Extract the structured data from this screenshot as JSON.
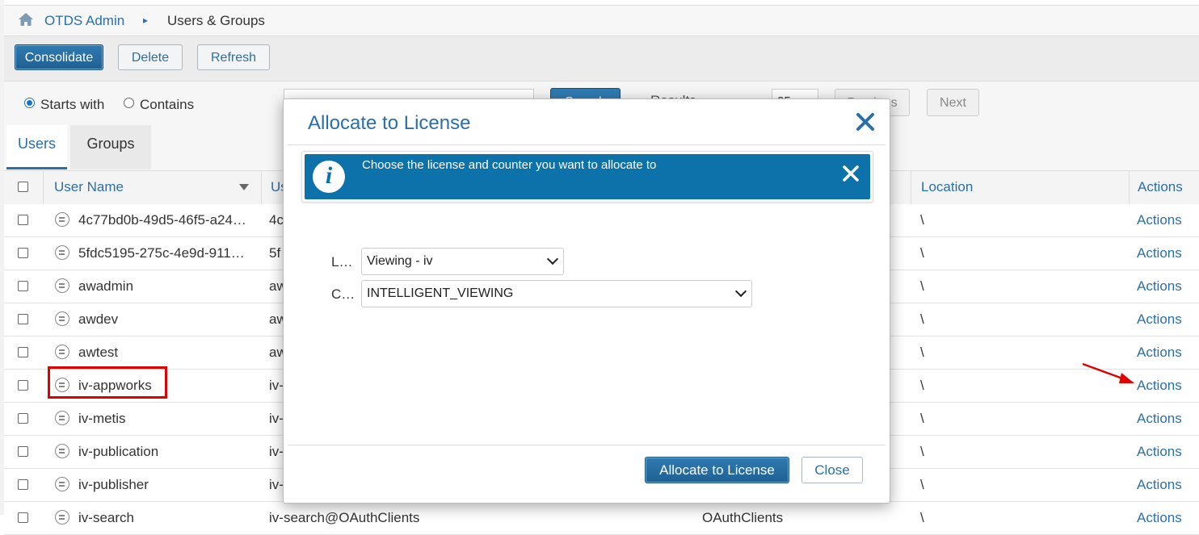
{
  "breadcrumb": {
    "home_icon": "home-icon",
    "root": "OTDS Admin",
    "separator": "▸",
    "current": "Users & Groups"
  },
  "toolbar": {
    "consolidate": "Consolidate",
    "delete": "Delete",
    "refresh": "Refresh"
  },
  "search": {
    "starts_with": "Starts with",
    "contains": "Contains",
    "selected_mode": "Starts with",
    "search_button": "Search",
    "results_label": "Results",
    "page_size": "25",
    "previous": "Previous",
    "next": "Next"
  },
  "tabs": [
    {
      "label": "Users",
      "active": true
    },
    {
      "label": "Groups",
      "active": false
    }
  ],
  "table": {
    "columns": {
      "user_name": "User Name",
      "user_id": "Us",
      "location": "Location",
      "actions": "Actions"
    },
    "rows": [
      {
        "name": "4c77bd0b-49d5-46f5-a24…",
        "usr": "4c",
        "oauth": "",
        "loc": "\\",
        "action": "Actions"
      },
      {
        "name": "5fdc5195-275c-4e9d-911…",
        "usr": "5f",
        "oauth": "",
        "loc": "\\",
        "action": "Actions"
      },
      {
        "name": "awadmin",
        "usr": "aw",
        "oauth": "",
        "loc": "\\",
        "action": "Actions"
      },
      {
        "name": "awdev",
        "usr": "aw",
        "oauth": "",
        "loc": "\\",
        "action": "Actions"
      },
      {
        "name": "awtest",
        "usr": "aw",
        "oauth": "",
        "loc": "\\",
        "action": "Actions"
      },
      {
        "name": "iv-appworks",
        "usr": "iv-",
        "oauth": "",
        "loc": "\\",
        "action": "Actions"
      },
      {
        "name": "iv-metis",
        "usr": "iv-",
        "oauth": "",
        "loc": "\\",
        "action": "Actions"
      },
      {
        "name": "iv-publication",
        "usr": "iv-",
        "oauth": "",
        "loc": "\\",
        "action": "Actions"
      },
      {
        "name": "iv-publisher",
        "usr": "iv-",
        "oauth": "",
        "loc": "\\",
        "action": "Actions"
      },
      {
        "name": "iv-search",
        "usr": "iv-search@OAuthClients",
        "oauth": "OAuthClients",
        "loc": "\\",
        "action": "Actions"
      }
    ]
  },
  "modal": {
    "title": "Allocate to License",
    "info_text": "Choose the license and counter you want to allocate to",
    "license_label": "L…",
    "license_value": "Viewing - iv",
    "counter_label": "C…",
    "counter_value": "INTELLIGENT_VIEWING",
    "allocate_button": "Allocate to License",
    "close_button": "Close"
  },
  "colors": {
    "accent": "#2a6fa8",
    "banner": "#0e72aa",
    "highlight": "#e00000"
  }
}
